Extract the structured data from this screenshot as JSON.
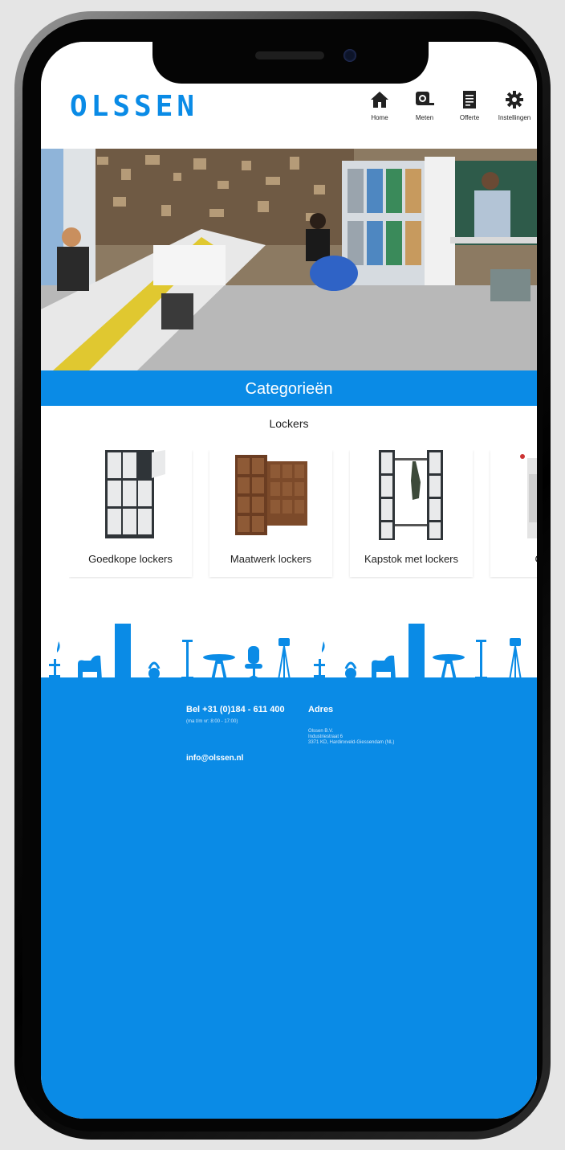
{
  "brand": {
    "logo_text": "OLSSEN",
    "accent_color": "#0a8be6"
  },
  "nav": [
    {
      "label": "Home",
      "icon": "home-icon"
    },
    {
      "label": "Meten",
      "icon": "tape-measure-icon"
    },
    {
      "label": "Offerte",
      "icon": "document-icon"
    },
    {
      "label": "Instellingen",
      "icon": "gear-icon"
    }
  ],
  "section": {
    "title": "Categorieën",
    "subtitle": "Lockers"
  },
  "categories": [
    {
      "label": "Goedkope lockers"
    },
    {
      "label": "Maatwerk lockers"
    },
    {
      "label": "Kapstok met lockers"
    },
    {
      "label": "Gevent"
    }
  ],
  "footer": {
    "phone": "Bel +31 (0)184 - 611 400",
    "hours": "(ma t/m vr: 8:00 - 17:00)",
    "email": "info@olssen.nl",
    "address_title": "Adres",
    "address_lines": [
      "Olssen B.V.",
      "Industriestraat 6",
      "3371 KD, Hardinxveld-Giessendam (NL)"
    ]
  }
}
